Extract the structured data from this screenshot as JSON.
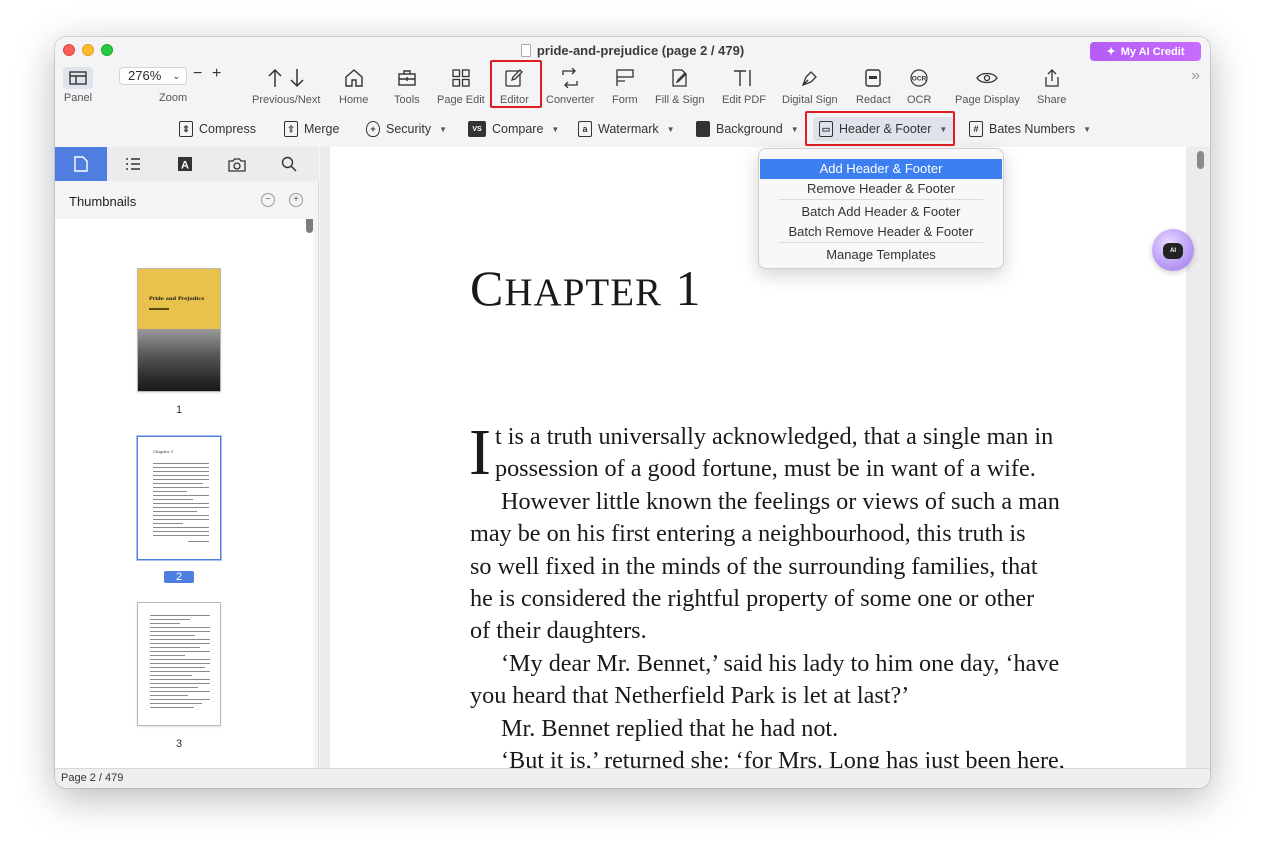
{
  "window": {
    "title": "pride-and-prejudice (page 2 / 479)",
    "ai_credit_label": "My AI Credit"
  },
  "toolbar": {
    "panel_label": "Panel",
    "zoom_value": "276%",
    "zoom_label": "Zoom",
    "zoom_minus": "−",
    "zoom_plus": "+",
    "items": [
      {
        "label": "Previous/Next",
        "icon": "arrow-up-down-icon"
      },
      {
        "label": "Home",
        "icon": "home-icon"
      },
      {
        "label": "Tools",
        "icon": "toolbox-icon"
      },
      {
        "label": "Page Edit",
        "icon": "grid-icon"
      },
      {
        "label": "Editor",
        "icon": "edit-icon"
      },
      {
        "label": "Converter",
        "icon": "convert-icon"
      },
      {
        "label": "Form",
        "icon": "form-icon"
      },
      {
        "label": "Fill & Sign",
        "icon": "fill-sign-icon"
      },
      {
        "label": "Edit PDF",
        "icon": "text-cursor-icon"
      },
      {
        "label": "Digital Sign",
        "icon": "pen-nib-icon"
      },
      {
        "label": "Redact",
        "icon": "redact-icon"
      },
      {
        "label": "OCR",
        "icon": "ocr-icon"
      },
      {
        "label": "Page Display",
        "icon": "eye-icon"
      },
      {
        "label": "Share",
        "icon": "share-icon"
      }
    ],
    "more": "»"
  },
  "toolbar2": {
    "compress": "Compress",
    "merge": "Merge",
    "security": "Security",
    "compare": "Compare",
    "watermark": "Watermark",
    "background": "Background",
    "header_footer": "Header & Footer",
    "bates_numbers": "Bates Numbers"
  },
  "sidebar": {
    "heading": "Thumbnails",
    "cover_title": "Pride and Prejudice",
    "page_labels": [
      "1",
      "2",
      "3"
    ],
    "thumb_chapter": "Chapter 1"
  },
  "document": {
    "chapter_first": "C",
    "chapter_rest": "HAPTER",
    "chapter_num": "1",
    "dropcap": "I",
    "line1": "t is a truth universally acknowledged, that a single man in",
    "line2": "possession of a good fortune, must be in want of a wife.",
    "line3": "However little known the feelings or views of such a man",
    "line4": "may be on his first entering a neighbourhood, this truth is",
    "line5": "so well fixed in the minds of the surrounding families, that",
    "line6": "he is considered the rightful property of some one or other",
    "line7": "of their daughters.",
    "line8": "‘My dear Mr. Bennet,’ said his lady to him one day, ‘have",
    "line9": "you heard that Netherfield Park is let at last?’",
    "line10": "Mr. Bennet replied that he had not.",
    "line11": "‘But it is,’ returned she: ‘for Mrs. Long has just been here,"
  },
  "ai_assistant_label": "AI",
  "menu": {
    "items": [
      "Add Header & Footer",
      "Remove Header & Footer",
      "Batch Add Header & Footer",
      "Batch Remove Header & Footer",
      "Manage Templates"
    ],
    "active_index": 0
  },
  "status": {
    "page_indicator": "Page 2 / 479"
  },
  "colors": {
    "accent": "#4f7ee0",
    "menu_highlight": "#3d7ef0",
    "annotation_red": "#e02020",
    "ai_purple": "#b45cf5"
  }
}
